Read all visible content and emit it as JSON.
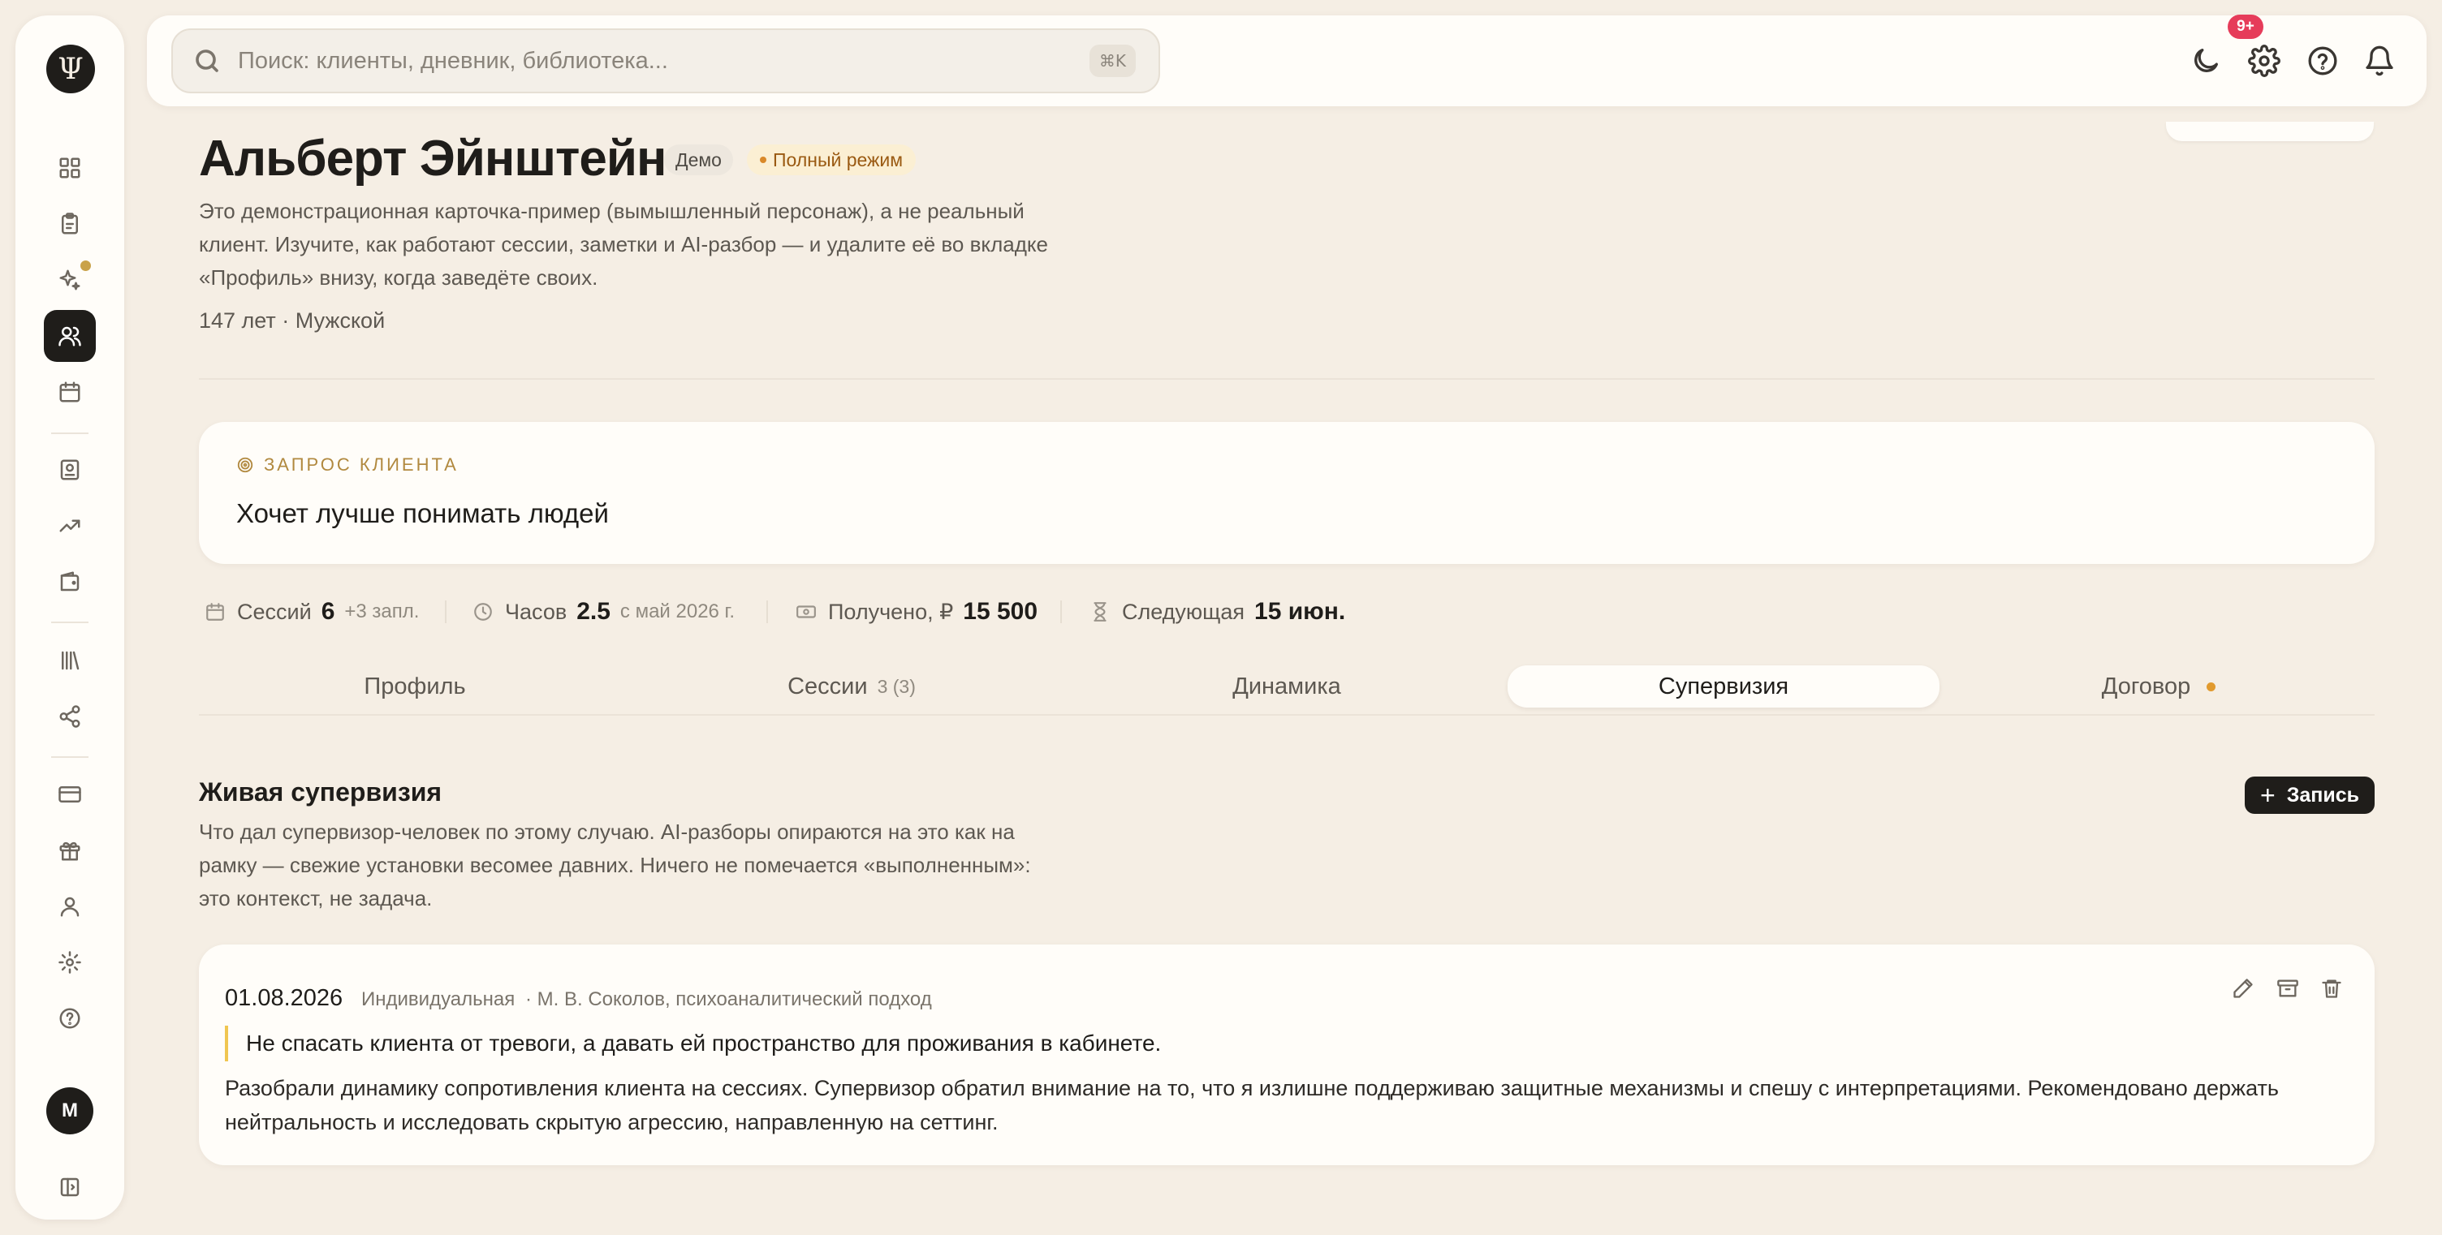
{
  "search": {
    "placeholder": "Поиск: клиенты, дневник, библиотека...",
    "shortcut": "⌘K"
  },
  "notifications": {
    "count": "9+"
  },
  "user": {
    "initial": "M"
  },
  "app": {
    "logo": "Ψ"
  },
  "client": {
    "name": "Альберт Эйнштейн",
    "tag_demo": "Демо",
    "tag_mode": "Полный режим",
    "description": "Это демонстрационная карточка-пример (вымышленный персонаж), а не реальный клиент. Изучите, как работают сессии, заметки и AI-разбор — и удалите её во вкладке «Профиль» внизу, когда заведёте своих.",
    "meta": "147 лет · Мужской"
  },
  "request": {
    "label": "ЗАПРОС КЛИЕНТА",
    "text": "Хочет лучше понимать людей"
  },
  "stats": {
    "sessions": {
      "label": "Сессий",
      "value": "6",
      "sub": "+3 запл."
    },
    "hours": {
      "label": "Часов",
      "value": "2.5",
      "sub": "с май 2026 г."
    },
    "received": {
      "label": "Получено, ₽",
      "value": "15 500"
    },
    "next": {
      "label": "Следующая",
      "value": "15 июн."
    }
  },
  "tabs": [
    {
      "label": "Профиль"
    },
    {
      "label": "Сессии",
      "sub": "3 (3)"
    },
    {
      "label": "Динамика"
    },
    {
      "label": "Супервизия"
    },
    {
      "label": "Договор"
    }
  ],
  "section": {
    "title": "Живая супервизия",
    "description": "Что дал супервизор-человек по этому случаю. AI-разборы опираются на это как на рамку — свежие установки весомее давних. Ничего не помечается «выполненным»: это контекст, не задача.",
    "add_label": "Запись"
  },
  "entry": {
    "date": "01.08.2026",
    "kind": "Индивидуальная",
    "supervisor": "· М. В. Соколов, психоаналитический подход",
    "quote": "Не спасать клиента от тревоги, а давать ей пространство для проживания в кабинете.",
    "body": "Разобрали динамику сопротивления клиента на сессиях. Супервизор обратил внимание на то, что я излишне поддерживаю защитные механизмы и спешу с интерпретациями. Рекомендовано держать нейтральность и исследовать скрытую агрессию, направленную на сеттинг."
  }
}
